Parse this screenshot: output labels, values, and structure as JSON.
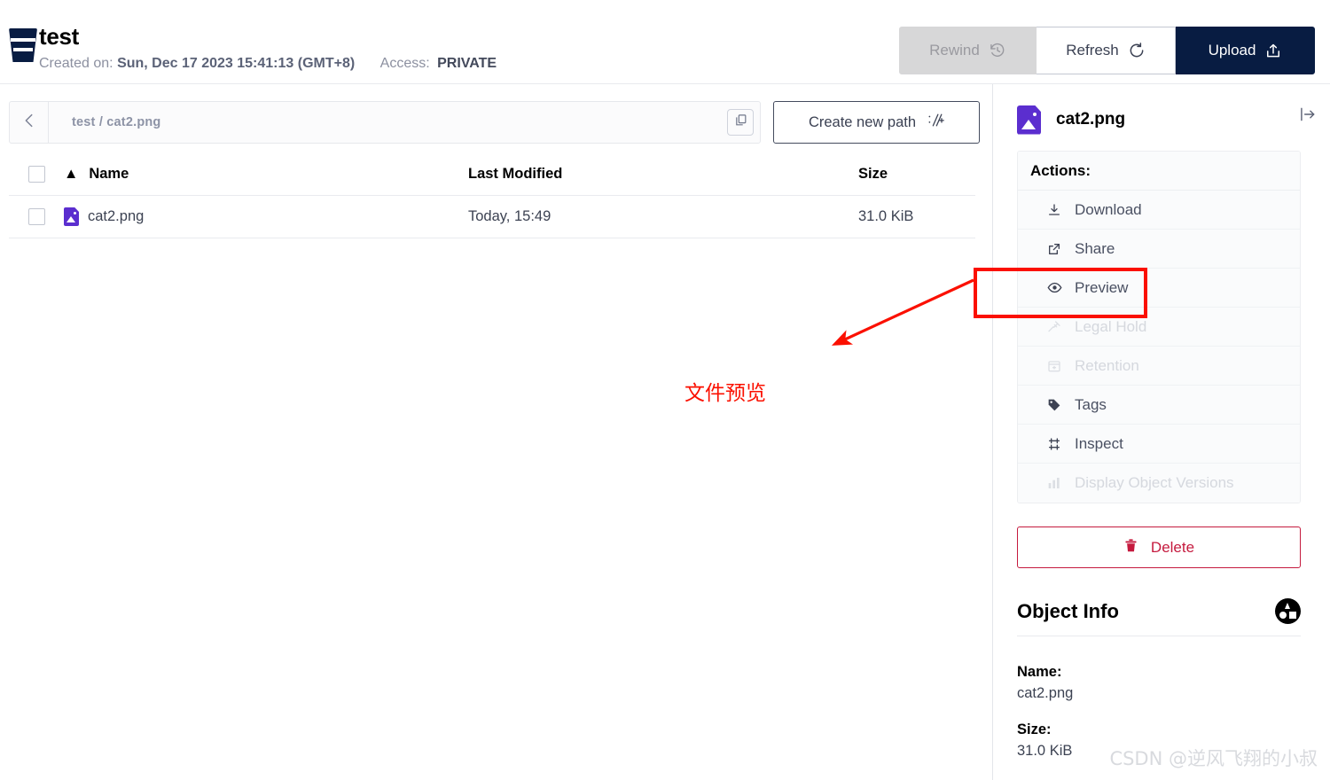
{
  "header": {
    "bucket_name": "test",
    "created_label": "Created on:",
    "created_value": "Sun, Dec 17 2023 15:41:13 (GMT+8)",
    "access_label": "Access:",
    "access_value": "PRIVATE",
    "buttons": {
      "rewind": "Rewind",
      "refresh": "Refresh",
      "upload": "Upload"
    }
  },
  "browser": {
    "breadcrumb": "test / cat2.png",
    "create_new_path": "Create new path",
    "columns": {
      "name": "Name",
      "last_modified": "Last Modified",
      "size": "Size"
    },
    "sort_indicator": "▲",
    "rows": [
      {
        "name": "cat2.png",
        "last_modified": "Today, 15:49",
        "size": "31.0 KiB"
      }
    ]
  },
  "detail_panel": {
    "file_name": "cat2.png",
    "actions_title": "Actions:",
    "actions": [
      {
        "label": "Download",
        "icon": "download-icon",
        "disabled": false
      },
      {
        "label": "Share",
        "icon": "share-icon",
        "disabled": false
      },
      {
        "label": "Preview",
        "icon": "eye-icon",
        "disabled": false
      },
      {
        "label": "Legal Hold",
        "icon": "gavel-icon",
        "disabled": true
      },
      {
        "label": "Retention",
        "icon": "calendar-icon",
        "disabled": true
      },
      {
        "label": "Tags",
        "icon": "tag-icon",
        "disabled": false
      },
      {
        "label": "Inspect",
        "icon": "inspect-icon",
        "disabled": false
      },
      {
        "label": "Display Object Versions",
        "icon": "versions-icon",
        "disabled": true
      }
    ],
    "delete_label": "Delete",
    "object_info_title": "Object Info",
    "info": [
      {
        "label": "Name:",
        "value": "cat2.png"
      },
      {
        "label": "Size:",
        "value": "31.0 KiB"
      }
    ]
  },
  "annotations": {
    "callout_text": "文件预览",
    "highlight_target": "Preview",
    "highlight_color": "#fb1000",
    "watermark": "CSDN @逆风飞翔的小叔"
  },
  "colors": {
    "brand_dark": "#081c42",
    "file_icon_purple": "#5b2ecf",
    "delete_red": "#c51a3e",
    "annotation_red": "#fb1000"
  }
}
